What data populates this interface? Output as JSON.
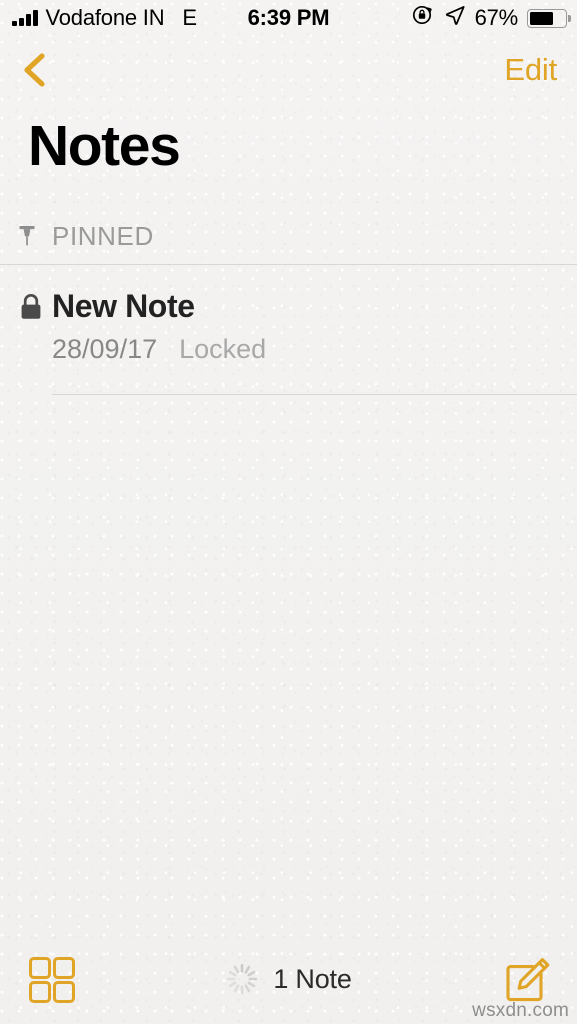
{
  "theme": {
    "accent": "#E0A526",
    "background": "#F3F2F1",
    "title_color": "#000000",
    "muted_color": "#9A9A9A",
    "separator_color": "#D7D7D7"
  },
  "status_bar": {
    "signal_icon": "signal-bars-icon",
    "carrier": "Vodafone IN",
    "network_type": "E",
    "time": "6:39 PM",
    "rotation_lock_icon": "rotation-lock-icon",
    "location_icon": "location-arrow-icon",
    "battery_percent": "67%",
    "battery_icon": "battery-icon",
    "battery_level": 67
  },
  "nav_bar": {
    "back_icon": "chevron-left-icon",
    "edit_label": "Edit"
  },
  "header": {
    "title": "Notes"
  },
  "pinned_section": {
    "icon": "pin-icon",
    "label": "PINNED"
  },
  "notes": [
    {
      "lock_icon": "lock-icon",
      "title": "New Note",
      "date": "28/09/17",
      "status": "Locked"
    }
  ],
  "toolbar": {
    "grid_view_icon": "grid-view-icon",
    "spinner_icon": "loading-spinner-icon",
    "count_label": "1 Note",
    "compose_icon": "compose-note-icon"
  },
  "watermark": {
    "text": "wsxdn.com"
  }
}
